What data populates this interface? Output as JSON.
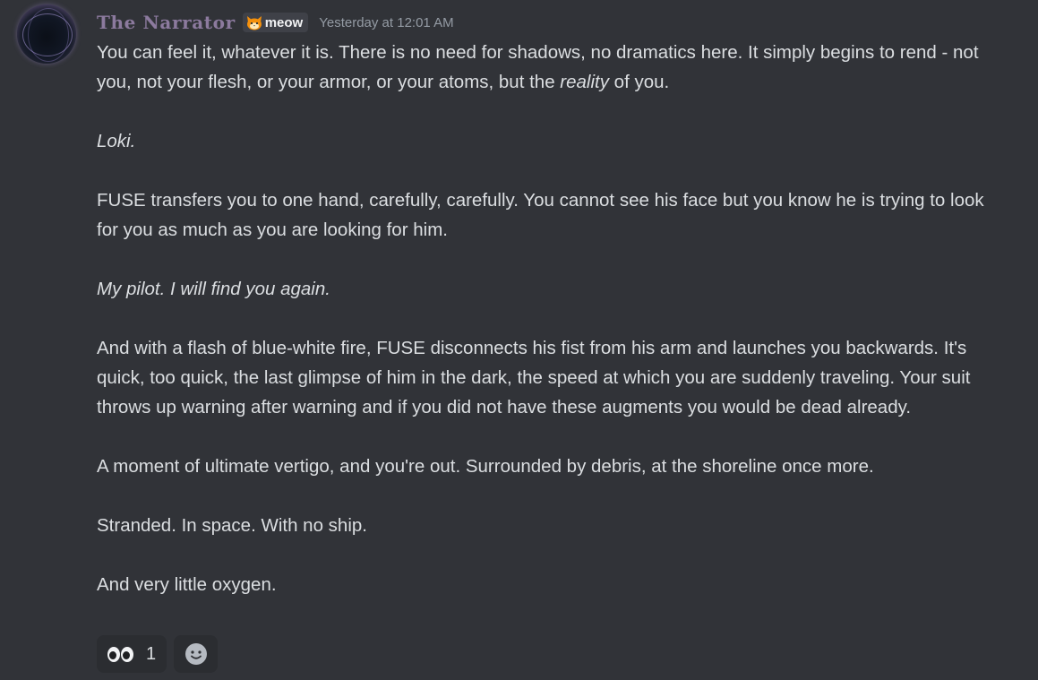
{
  "message": {
    "author": "The Narrator",
    "tag": {
      "icon": "cat-face-icon",
      "label": "meow"
    },
    "timestamp": "Yesterday at 12:01 AM",
    "paragraphs": {
      "p1_a": "You can feel it, whatever it is. There is no need for shadows, no dramatics here. It simply begins to rend - not you, not your flesh, or your armor, or your atoms, but the ",
      "p1_b": "reality",
      "p1_c": " of you.",
      "p2": "Loki.",
      "p3": "FUSE transfers you to one hand, carefully, carefully. You cannot see his face but you know he is trying to look for you as much as you are looking for him.",
      "p4": "My pilot. I will find you again.",
      "p5": "And with a flash of blue-white fire, FUSE disconnects his fist from his arm and launches you backwards. It's quick, too quick, the last glimpse of him in the dark, the speed at which you are suddenly traveling. Your suit throws up warning after warning and if you did not have these augments you would be dead already.",
      "p6": "A moment of ultimate vertigo, and you're out. Surrounded by debris, at the shoreline once more.",
      "p7": "Stranded. In space. With no ship.",
      "p8": "And very little oxygen."
    },
    "reactions": [
      {
        "emoji": "eyes-icon",
        "count": "1"
      }
    ],
    "add_reaction_icon": "smiley-add-icon"
  },
  "colors": {
    "background": "#313338",
    "text": "#dbdee1",
    "author": "#8c7a9e",
    "timestamp": "#949ba4",
    "reaction_bg": "#2b2d31",
    "tag_bg": "#3f4148"
  }
}
